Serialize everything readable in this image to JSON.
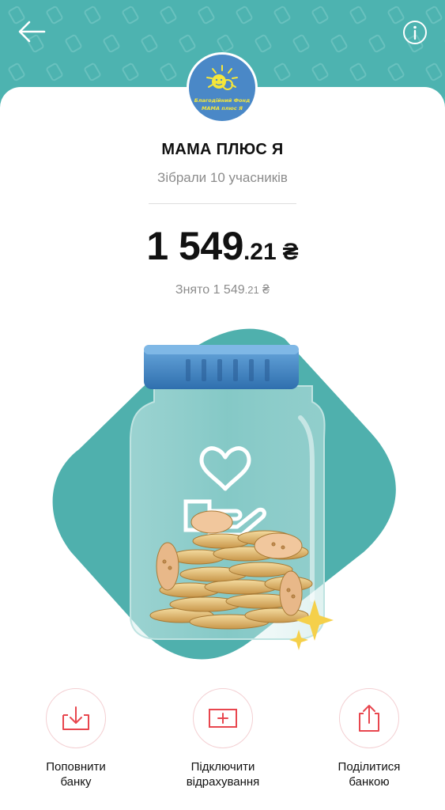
{
  "header": {
    "background": "#4db3b0",
    "back_icon": "arrow-left-icon",
    "info_icon": "info-icon"
  },
  "jar": {
    "logo_text_line1": "Благодійний Фонд",
    "logo_text_line2": "МАМА плюс Я",
    "title": "МАМА ПЛЮС Я",
    "subtitle": "Зібрали 10 учасників",
    "balance": {
      "integer": "1 549",
      "fraction": ".21",
      "currency": "₴"
    },
    "withdrawn": {
      "label": "Знято 1 549",
      "fraction": ".21",
      "currency": "₴"
    }
  },
  "actions": [
    {
      "icon": "download-tray-icon",
      "line1": "Поповнити",
      "line2": "банку"
    },
    {
      "icon": "card-plus-icon",
      "line1": "Підключити",
      "line2": "відрахування"
    },
    {
      "icon": "share-icon",
      "line1": "Поділитися",
      "line2": "банкою"
    }
  ],
  "colors": {
    "accent": "#4db3b0",
    "action_icon": "#e8464e",
    "logo_bg": "#4a88c7"
  }
}
